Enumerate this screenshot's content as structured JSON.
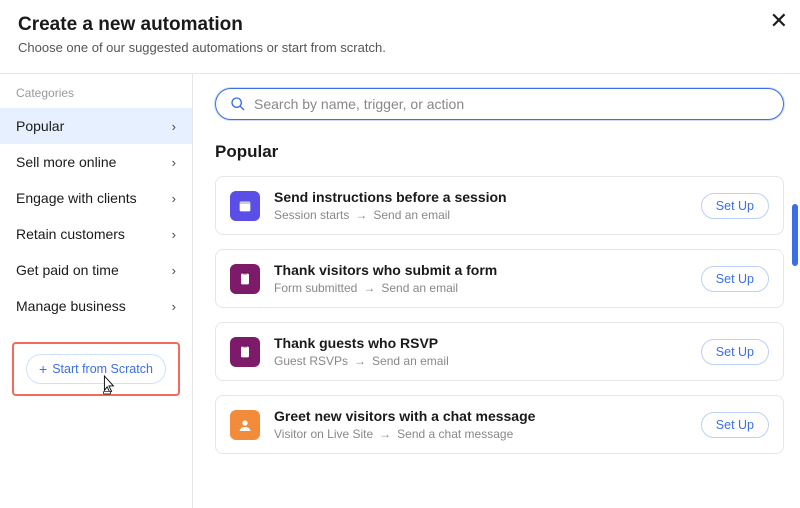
{
  "header": {
    "title": "Create a new automation",
    "subtitle": "Choose one of our suggested automations or start from scratch."
  },
  "sidebar": {
    "heading": "Categories",
    "items": [
      {
        "label": "Popular"
      },
      {
        "label": "Sell more online"
      },
      {
        "label": "Engage with clients"
      },
      {
        "label": "Retain customers"
      },
      {
        "label": "Get paid on time"
      },
      {
        "label": "Manage business"
      }
    ],
    "scratch_label": "Start from Scratch"
  },
  "search": {
    "placeholder": "Search by name, trigger, or action"
  },
  "section_title": "Popular",
  "setup_label": "Set Up",
  "cards": [
    {
      "title": "Send instructions before a session",
      "trigger": "Session starts",
      "action": "Send an email",
      "icon_bg": "#5a4ee6",
      "icon": "calendar"
    },
    {
      "title": "Thank visitors who submit a form",
      "trigger": "Form submitted",
      "action": "Send an email",
      "icon_bg": "#7d1a6a",
      "icon": "clipboard"
    },
    {
      "title": "Thank guests who RSVP",
      "trigger": "Guest RSVPs",
      "action": "Send an email",
      "icon_bg": "#7d1a6a",
      "icon": "clipboard"
    },
    {
      "title": "Greet new visitors with a chat message",
      "trigger": "Visitor on Live Site",
      "action": "Send a chat message",
      "icon_bg": "#f28c3b",
      "icon": "person"
    }
  ]
}
